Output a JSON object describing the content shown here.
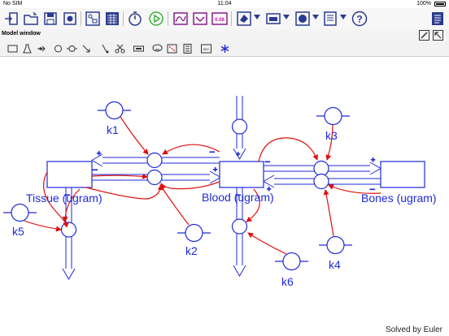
{
  "status": {
    "carrier": "No SIM",
    "time": "11:04",
    "battery": "100%"
  },
  "toolbar": {
    "icons": [
      "open-icon",
      "folder-icon",
      "save-icon",
      "record-icon",
      "model-icon",
      "table-icon",
      "stopwatch-icon",
      "run-icon",
      "graph-icon",
      "chart-icon",
      "number-display-icon",
      "paint-icon",
      "window-icon",
      "globe-icon",
      "document-icon",
      "help-icon",
      "notes-icon"
    ],
    "mode_value": "0.08"
  },
  "model_window": {
    "title": "Model window"
  },
  "model": {
    "compartments": {
      "tissue": "Tissue (ugram)",
      "blood": "Blood (ugram)",
      "bones": "Bones (ugram)"
    },
    "params": [
      "k1",
      "k2",
      "k3",
      "k4",
      "k5",
      "k6"
    ]
  },
  "colors": {
    "flow": "#1e2ad8",
    "arrow": "#e01010",
    "accent": "#2a3b8f"
  },
  "footer": {
    "solved_by": "Solved by Euler"
  }
}
